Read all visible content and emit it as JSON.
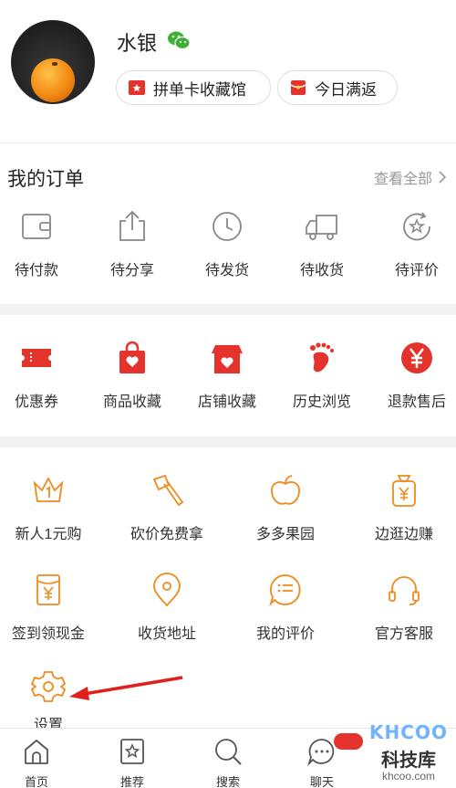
{
  "profile": {
    "username": "水银",
    "pill_collection": "拼单卡收藏馆",
    "pill_rebate": "今日满返"
  },
  "orders": {
    "title": "我的订单",
    "view_all": "查看全部",
    "items": [
      {
        "label": "待付款",
        "icon": "wallet-icon"
      },
      {
        "label": "待分享",
        "icon": "share-icon"
      },
      {
        "label": "待发货",
        "icon": "clock-icon"
      },
      {
        "label": "待收货",
        "icon": "truck-icon"
      },
      {
        "label": "待评价",
        "icon": "review-icon"
      }
    ]
  },
  "shortcuts": {
    "items": [
      {
        "label": "优惠券",
        "icon": "coupon-icon"
      },
      {
        "label": "商品收藏",
        "icon": "bag-heart-icon"
      },
      {
        "label": "店铺收藏",
        "icon": "store-heart-icon"
      },
      {
        "label": "历史浏览",
        "icon": "footprint-icon"
      },
      {
        "label": "退款售后",
        "icon": "refund-yen-icon"
      }
    ]
  },
  "services": {
    "row1": [
      {
        "label": "新人1元购",
        "icon": "crown-icon"
      },
      {
        "label": "砍价免费拿",
        "icon": "axe-icon"
      },
      {
        "label": "多多果园",
        "icon": "apple-icon"
      },
      {
        "label": "边逛边赚",
        "icon": "money-bag-icon"
      }
    ],
    "row2": [
      {
        "label": "签到领现金",
        "icon": "cash-envelope-icon"
      },
      {
        "label": "收货地址",
        "icon": "location-icon"
      },
      {
        "label": "我的评价",
        "icon": "comment-icon"
      },
      {
        "label": "官方客服",
        "icon": "headset-icon"
      }
    ],
    "settings": {
      "label": "设置",
      "icon": "gear-icon"
    }
  },
  "tabbar": {
    "items": [
      {
        "label": "首页",
        "icon": "home-icon"
      },
      {
        "label": "推荐",
        "icon": "recommend-icon"
      },
      {
        "label": "搜索",
        "icon": "search-icon"
      },
      {
        "label": "聊天",
        "icon": "chat-icon"
      }
    ]
  },
  "watermark": {
    "logo": "KHCOO",
    "name": "科技库",
    "url": "khcoo.com"
  },
  "colors": {
    "accent_red": "#e4322c",
    "accent_orange": "#f08a1c",
    "gray_text": "#999999"
  }
}
